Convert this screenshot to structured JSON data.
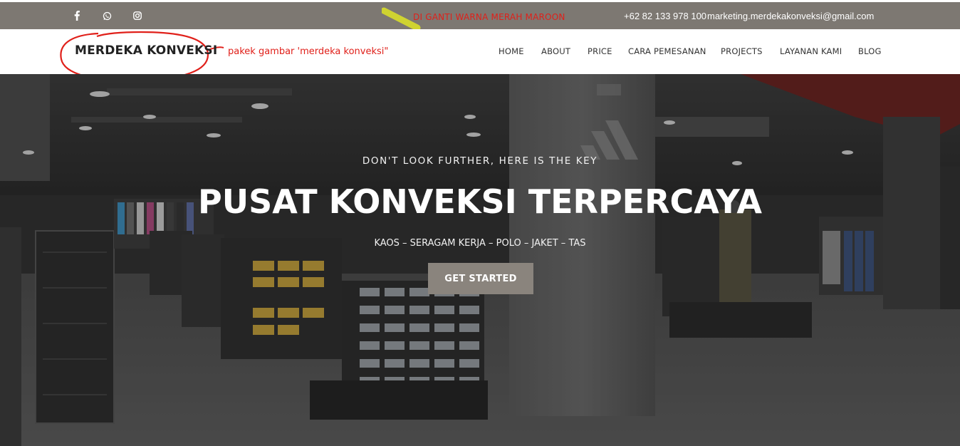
{
  "topbar": {
    "social": [
      {
        "icon": "facebook-icon",
        "glyph": "f"
      },
      {
        "icon": "whatsapp-icon"
      },
      {
        "icon": "instagram-icon"
      }
    ],
    "annotation": "DI GANTI WARNA MERAH MAROON",
    "phone": "+62 82 133 978 100",
    "email": "marketing.merdekakonveksi@gmail.com",
    "bg_color": "#7d7872"
  },
  "navbar": {
    "logo": "MERDEKA KONVEKSI",
    "logo_note": "pakek gambar 'merdeka konveksi\"",
    "items": [
      "HOME",
      "ABOUT",
      "PRICE",
      "CARA PEMESANAN",
      "PROJECTS",
      "LAYANAN KAMI",
      "BLOG"
    ]
  },
  "hero": {
    "kicker": "DON'T LOOK FURTHER, HERE IS THE KEY",
    "title": "PUSAT KONVEKSI TERPERCAYA",
    "subtitle": "KAOS – SERAGAM KERJA – POLO – JAKET – TAS",
    "button": "GET STARTED",
    "button_color": "#8a847d",
    "annotation_color": "#e0201a"
  }
}
